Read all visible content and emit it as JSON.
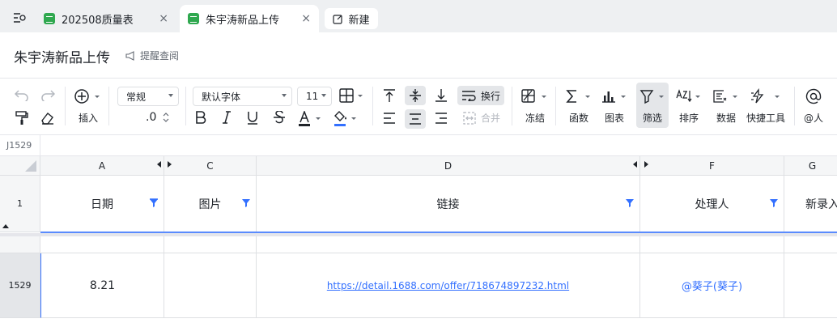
{
  "tabs": [
    {
      "label": "202508质量表",
      "close": "×"
    },
    {
      "label": "朱宇涛新品上传",
      "close": "×"
    }
  ],
  "new_tab_label": "新建",
  "doc": {
    "title": "朱宇涛新品上传",
    "remind_label": "提醒查阅"
  },
  "toolbar": {
    "insert_label": "插入",
    "format_value": "常规",
    "decimal_label": ".0",
    "font_value": "默认字体",
    "size_value": "11",
    "wrap_label": "换行",
    "merge_label": "合并",
    "freeze_label": "冻结",
    "func_label": "函数",
    "chart_label": "图表",
    "filter_label": "筛选",
    "sort_label": "排序",
    "data_label": "数据",
    "quick_label": "快捷工具",
    "at_label": "@人",
    "font_color": "#1f2329",
    "fill_color": "#3370ff"
  },
  "cell_ref": "J1529",
  "columns": [
    "A",
    "C",
    "D",
    "F",
    "G"
  ],
  "header_row": {
    "num": "1",
    "cells": [
      "日期",
      "图片",
      "链接",
      "处理人",
      "新录入"
    ]
  },
  "data_row": {
    "num": "1529",
    "date": "8.21",
    "image": "",
    "link": "https://detail.1688.com/offer/718674897232.html",
    "handler": "@葵子(葵子)"
  },
  "colors": {
    "accent": "#3370ff",
    "green": "#2fa84f"
  }
}
